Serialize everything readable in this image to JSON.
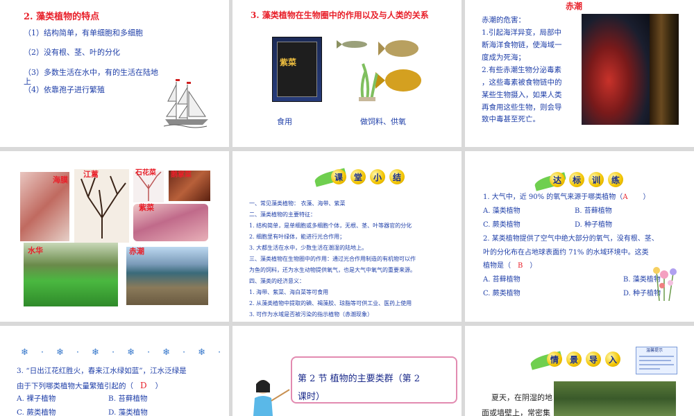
{
  "s1": {
    "title": "2. 藻类植物的特点",
    "items": [
      "（1）结构简单，有单细胞和多细胞",
      "（2）没有根、茎、叶的分化",
      "（3）多数生活在水中，有的生活在陆地",
      "上",
      "（4）依靠孢子进行繁殖"
    ]
  },
  "s2": {
    "title": "3. 藻类植物在生物圈中的作用以及与人类的关系",
    "caption_left": "食用",
    "caption_right": "做饲料、供氧",
    "package_text": "紫菜"
  },
  "s3": {
    "title": "赤潮",
    "lines": [
      "赤潮的危害：",
      "1.引起海洋异变，局部中",
      "断海洋食物链，使海域一",
      "度成为死海；",
      "2.有些赤潮生物分泌毒素",
      "，这些毒素被食物链中的",
      "某些生物摄入，如果人类",
      "再食用这些生物，则会导",
      "致中毒甚至死亡。"
    ]
  },
  "s4": {
    "labels": {
      "a": "海膜",
      "b": "江蓠",
      "c": "石花菜",
      "d": "鹅掌菜",
      "e": "紫菜",
      "f": "水华",
      "g": "赤潮"
    }
  },
  "s5": {
    "badge": [
      "课",
      "堂",
      "小",
      "结"
    ],
    "lines": [
      "一、常见藻类植物： 衣藻、海带、紫菜",
      "二、藻类植物的主要特征：",
      "1. 结构简单，是单细胞或多细胞个体，无根、茎、叶等器官的分化",
      "2. 细胞里有叶绿体，能进行光合作用；",
      "3. 大都生活在水中，少数生活在潮湿的陆地上。",
      "三、藻类植物在生物圈中的作用：通过光合作用制造的有机物可以作",
      "为鱼的饲料，还为水生动物提供氧气，也是大气中氧气的重要来源。",
      "四、藻类的经济意义：",
      "1. 海带、紫菜、海白菜等可食用",
      "2. 从藻类植物中提取的碘、褐藻胶、琼脂等可供工业、医药上使用",
      "3. 可作为水域是否被污染的指示植物（赤潮现象）"
    ]
  },
  "s6": {
    "badge": [
      "达",
      "标",
      "训",
      "练"
    ],
    "q1": "1. 大气中，近 90% 的氧气来源于哪类植物（",
    "q1_answer": "A",
    "q1_close": "）",
    "q1_opts": [
      "A. 藻类植物",
      "B. 苔藓植物",
      "C. 蕨类植物",
      "D. 种子植物"
    ],
    "q2_lines": [
      "2. 某类植物提供了空气中绝大部分的氧气，没有根、茎、",
      "叶的分化布在占地球表面约      71% 的水域环境中。这类"
    ],
    "q2_tail": "植物是（",
    "q2_answer": "B",
    "q2_close": "）",
    "q2_opts": [
      "A. 苔藓植物",
      "B. 藻类植物",
      "C. 蕨类植物",
      "D. 种子植物"
    ]
  },
  "s7": {
    "q_line1": "3. “日出江花红胜火，春来江水绿如蓝”，江水泛绿是",
    "q_line2": "由于下列哪类植物大量繁殖引起的（",
    "answer": "D",
    "close": "）",
    "opts": [
      "A. 裸子植物",
      "B. 苔藓植物",
      "C. 蕨类植物",
      "D. 藻类植物"
    ]
  },
  "s8": {
    "title_line1": "第 2 节   植物的主要类群（第 2",
    "title_line2": "课时）"
  },
  "s9": {
    "badge": [
      "情",
      "景",
      "导",
      "入"
    ],
    "note": "温馨提示",
    "text1": "夏天，在阴湿的地",
    "text2": "面或墙壁上，常密集"
  }
}
